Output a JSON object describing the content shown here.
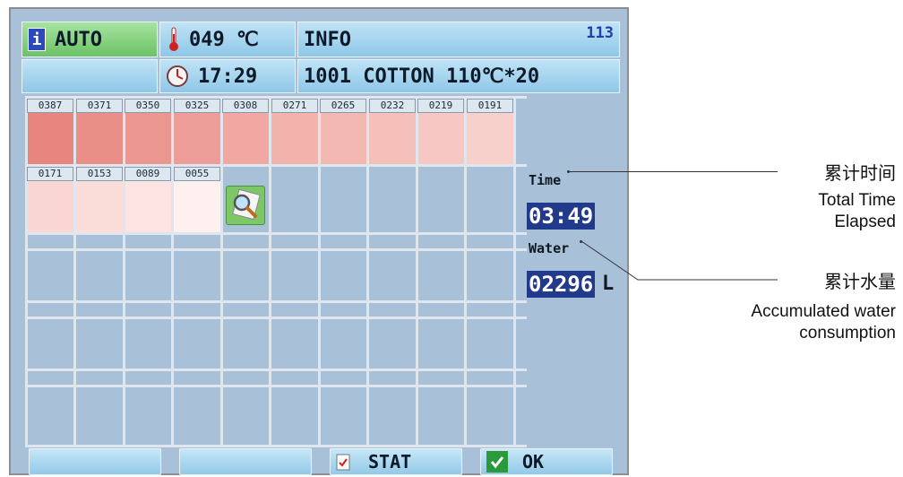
{
  "header": {
    "info_icon_glyph": "i",
    "mode": "AUTO",
    "temperature": "049 ℃",
    "info_label": "INFO",
    "badge": "113",
    "clock": "17:29",
    "program": "1001 COTTON 110℃*20"
  },
  "grid": {
    "row1_labels": [
      "0387",
      "0371",
      "0350",
      "0325",
      "0308",
      "0271",
      "0265",
      "0232",
      "0219",
      "0191"
    ],
    "row2_labels": [
      "0171",
      "0153",
      "0089",
      "0055"
    ],
    "row1_colors": [
      "#e8857e",
      "#ea8f88",
      "#ec9690",
      "#ee9e98",
      "#f1a8a2",
      "#f3b3ad",
      "#f4b8b2",
      "#f6c0ba",
      "#f7c8c3",
      "#f8d0cb"
    ],
    "row2_colors": [
      "#f9d6d2",
      "#fadcd8",
      "#fbe4e1",
      "#fdf0ee"
    ],
    "magnifier_icon": "magnifier-icon"
  },
  "side": {
    "time_label": "Time",
    "time_value": "03:49",
    "water_label": "Water",
    "water_value": "02296",
    "water_unit": "L"
  },
  "bottom_bar": {
    "stat_label": "STAT",
    "ok_label": "OK"
  },
  "annotations": {
    "time_cn": "累计时间",
    "time_en_line1": "Total Time",
    "time_en_line2": "Elapsed",
    "water_cn": "累计水量",
    "water_en_line1": "Accumulated water",
    "water_en_line2": "consumption"
  },
  "colors": {
    "screen_bg": "#a8c0d8",
    "value_bg": "#223a8c",
    "header_cell": "#a9d6f0",
    "info_cell": "#8fd489"
  }
}
